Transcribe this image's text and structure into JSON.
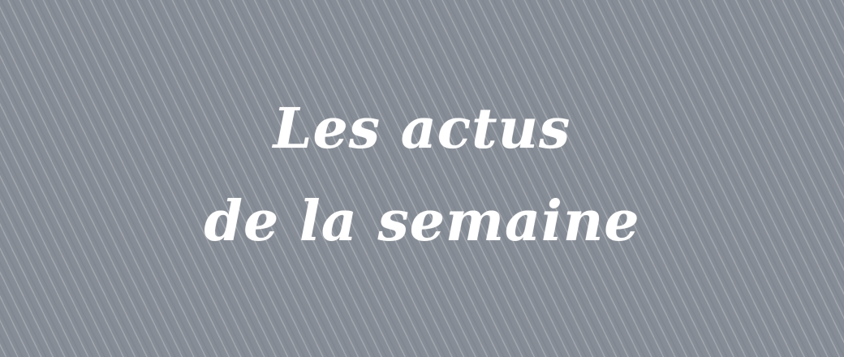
{
  "banner": {
    "line1": "Les actus",
    "line2": "de la semaine",
    "background_color": "#878d96",
    "text_color": "#ffffff"
  }
}
